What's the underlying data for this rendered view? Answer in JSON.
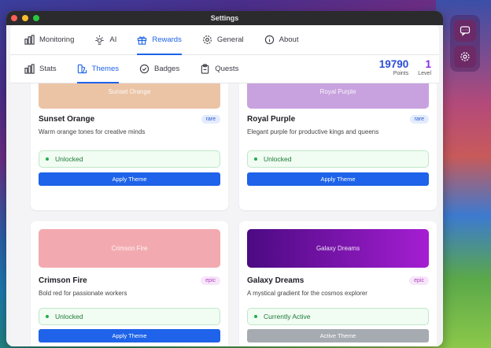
{
  "window": {
    "title": "Settings"
  },
  "nav": {
    "main_tabs": [
      {
        "label": "Monitoring",
        "icon": "chart-icon"
      },
      {
        "label": "AI",
        "icon": "sun-icon"
      },
      {
        "label": "Rewards",
        "icon": "gift-icon",
        "active": true
      },
      {
        "label": "General",
        "icon": "gear-icon"
      },
      {
        "label": "About",
        "icon": "info-icon"
      }
    ],
    "sub_tabs": [
      {
        "label": "Stats",
        "icon": "chart-icon"
      },
      {
        "label": "Themes",
        "icon": "palette-icon",
        "active": true
      },
      {
        "label": "Badges",
        "icon": "check-circle-icon"
      },
      {
        "label": "Quests",
        "icon": "clipboard-icon"
      }
    ]
  },
  "stats": {
    "points": "19790",
    "points_label": "Points",
    "level": "1",
    "level_label": "Level"
  },
  "themes": [
    {
      "preview_label": "Sunset Orange",
      "name": "Sunset Orange",
      "rarity": "rare",
      "description": "Warm orange tones for creative minds",
      "status": "Unlocked",
      "button": "Apply Theme",
      "color": "#ebc4a6"
    },
    {
      "preview_label": "Royal Purple",
      "name": "Royal Purple",
      "rarity": "rare",
      "description": "Elegant purple for productive kings and queens",
      "status": "Unlocked",
      "button": "Apply Theme",
      "color": "#c8a2de"
    },
    {
      "preview_label": "Crimson Fire",
      "name": "Crimson Fire",
      "rarity": "epic",
      "description": "Bold red for passionate workers",
      "status": "Unlocked",
      "button": "Apply Theme",
      "color": "#f2aab0"
    },
    {
      "preview_label": "Galaxy Dreams",
      "name": "Galaxy Dreams",
      "rarity": "epic",
      "description": "A mystical gradient for the cosmos explorer",
      "status": "Currently Active",
      "button": "Active Theme",
      "color_from": "#4b0a82",
      "color_to": "#a51ed2"
    }
  ],
  "side_panel": {
    "icons": [
      "chat-icon",
      "gear-icon"
    ]
  },
  "colors": {
    "accent": "#1e63e9",
    "level": "#8a2be2",
    "rare": "#2a58d0",
    "epic": "#b23fc4",
    "success": "#1d7a36"
  }
}
